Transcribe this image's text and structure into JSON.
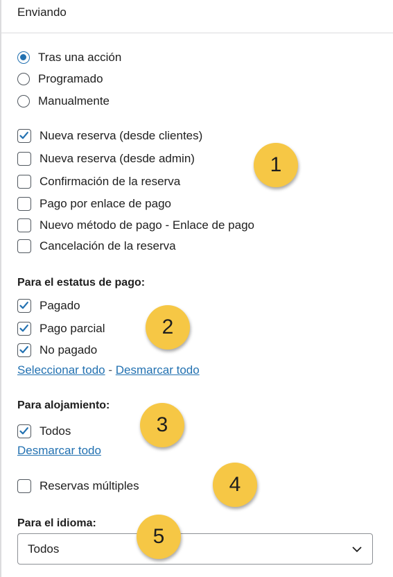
{
  "header": {
    "title": "Enviando"
  },
  "send_mode": {
    "options": [
      {
        "label": "Tras una acción",
        "checked": true
      },
      {
        "label": "Programado",
        "checked": false
      },
      {
        "label": "Manualmente",
        "checked": false
      }
    ]
  },
  "triggers": {
    "items": [
      {
        "label": "Nueva reserva (desde clientes)",
        "checked": true
      },
      {
        "label": "Nueva reserva (desde admin)",
        "checked": false
      },
      {
        "label": "Confirmación de la reserva",
        "checked": false
      },
      {
        "label": "Pago por enlace de pago",
        "checked": false
      },
      {
        "label": "Nuevo método de pago - Enlace de pago",
        "checked": false
      },
      {
        "label": "Cancelación de la reserva",
        "checked": false
      }
    ]
  },
  "payment_status": {
    "title": "Para el estatus de pago:",
    "items": [
      {
        "label": "Pagado",
        "checked": true
      },
      {
        "label": "Pago parcial",
        "checked": true
      },
      {
        "label": "No pagado",
        "checked": true
      }
    ],
    "select_all": "Seleccionar todo",
    "separator": "-",
    "deselect_all": "Desmarcar todo"
  },
  "accommodation": {
    "title": "Para alojamiento:",
    "items": [
      {
        "label": "Todos",
        "checked": true
      }
    ],
    "deselect_all": "Desmarcar todo"
  },
  "multiple": {
    "label": "Reservas múltiples",
    "checked": false
  },
  "language": {
    "title": "Para el idioma:",
    "selected": "Todos"
  },
  "callouts": [
    "1",
    "2",
    "3",
    "4",
    "5"
  ],
  "colors": {
    "accent": "#2271b1",
    "callout": "#f6c745",
    "border": "#dcdcde"
  }
}
